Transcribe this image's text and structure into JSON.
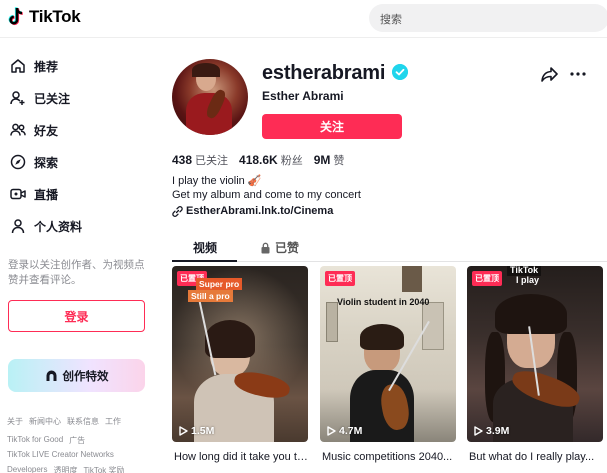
{
  "app": {
    "brand": "TikTok"
  },
  "search": {
    "placeholder": "搜索"
  },
  "sidebar": {
    "items": [
      {
        "label": "推荐",
        "icon": "home-icon"
      },
      {
        "label": "已关注",
        "icon": "following-icon"
      },
      {
        "label": "好友",
        "icon": "friends-icon"
      },
      {
        "label": "探索",
        "icon": "explore-icon"
      },
      {
        "label": "直播",
        "icon": "live-icon"
      },
      {
        "label": "个人资料",
        "icon": "profile-icon"
      }
    ],
    "login_tip": "登录以关注创作者、为视频点赞并查看评论。",
    "login_button": "登录",
    "effects_button": "创作特效",
    "footer": [
      [
        "关于",
        "新闻中心",
        "联系信息",
        "工作"
      ],
      [
        "TikTok for Good",
        "广告"
      ],
      [
        "TikTok LIVE Creator Networks"
      ],
      [
        "Developers",
        "透明度",
        "TikTok 奖励"
      ]
    ]
  },
  "profile": {
    "username": "estherabrami",
    "nickname": "Esther Abrami",
    "follow_button": "关注",
    "stats": [
      {
        "value": "438",
        "label": "已关注"
      },
      {
        "value": "418.6K",
        "label": "粉丝"
      },
      {
        "value": "9M",
        "label": "赞"
      }
    ],
    "bio_line1": "I play the violin 🎻",
    "bio_line2": "Get my album and come to my concert",
    "link": "EstherAbrami.lnk.to/Cinema"
  },
  "tabs": [
    {
      "label": "视频",
      "active": true
    },
    {
      "label": "已赞",
      "active": false,
      "icon": "lock-icon"
    }
  ],
  "videos": [
    {
      "pinned": "已置顶",
      "overlay1": "Super pro",
      "overlay2": "Still a pro",
      "views": "1.5M",
      "caption": "How long did it take you to..."
    },
    {
      "pinned": "已置顶",
      "overlay1": "Violin student in 2040",
      "views": "4.7M",
      "caption": "Music competitions 2040..."
    },
    {
      "pinned": "已置顶",
      "overlay1": "TikTok",
      "overlay2": "I play",
      "views": "3.9M",
      "caption": "But what do I really play..."
    }
  ],
  "colors": {
    "accent": "#fe2c55",
    "verified": "#20d5ec",
    "text": "#161823",
    "muted": "#8a8b91"
  }
}
